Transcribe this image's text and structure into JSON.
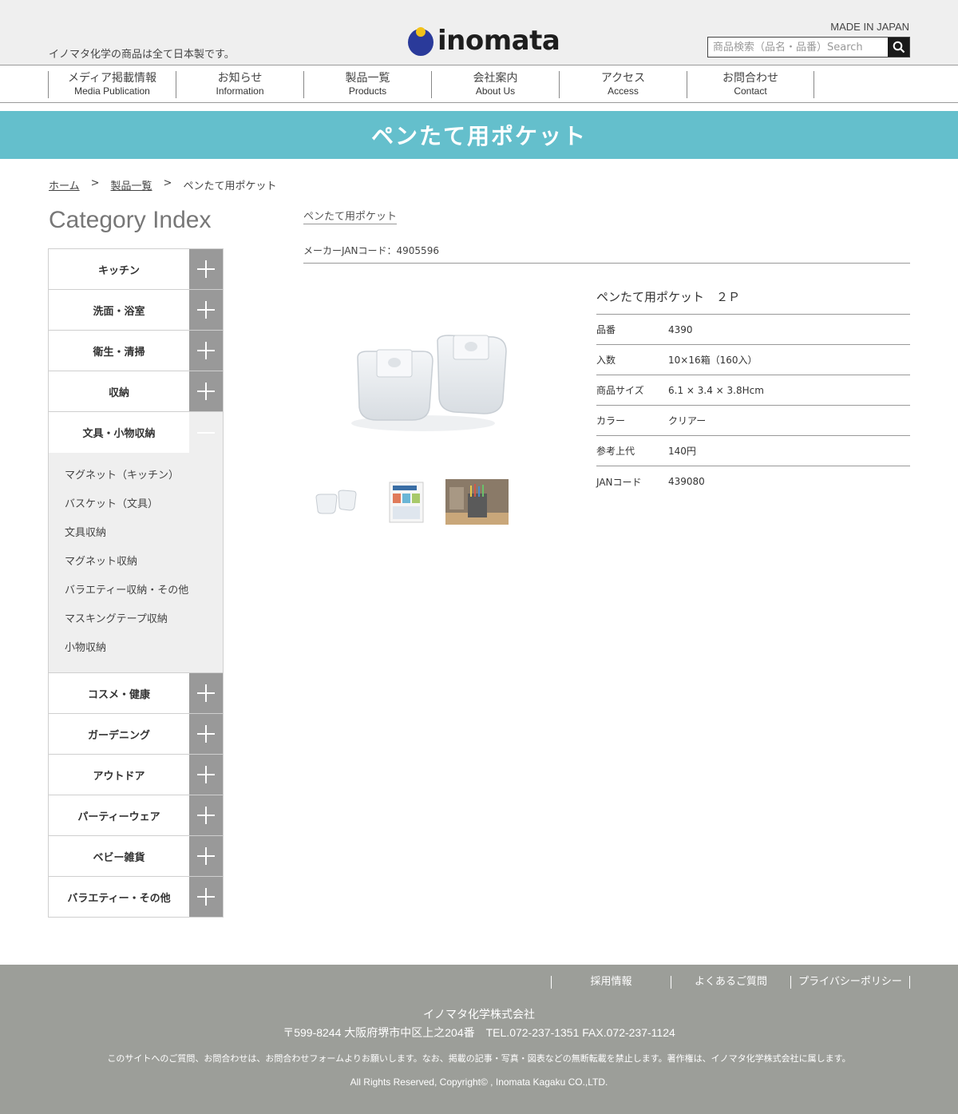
{
  "header": {
    "tagline": "イノマタ化学の商品は全て日本製です。",
    "logo_text": "inomata",
    "made_in": "MADE IN JAPAN",
    "search_placeholder": "商品検索（品名・品番）Search"
  },
  "nav": [
    {
      "jp": "メディア掲載情報",
      "en": "Media Publication"
    },
    {
      "jp": "お知らせ",
      "en": "Information"
    },
    {
      "jp": "製品一覧",
      "en": "Products"
    },
    {
      "jp": "会社案内",
      "en": "About Us"
    },
    {
      "jp": "アクセス",
      "en": "Access"
    },
    {
      "jp": "お問合わせ",
      "en": "Contact"
    }
  ],
  "banner_title": "ペンたて用ポケット",
  "breadcrumb": {
    "home": "ホーム",
    "sep": ">",
    "products": "製品一覧",
    "current": "ペンたて用ポケット"
  },
  "sidebar": {
    "title": "Category Index",
    "categories": [
      {
        "label": "キッチン"
      },
      {
        "label": "洗面・浴室"
      },
      {
        "label": "衛生・清掃"
      },
      {
        "label": "収納"
      },
      {
        "label": "文具・小物収納"
      },
      {
        "label": "コスメ・健康"
      },
      {
        "label": "ガーデニング"
      },
      {
        "label": "アウトドア"
      },
      {
        "label": "パーティーウェア"
      },
      {
        "label": "ベビー雑貨"
      },
      {
        "label": "バラエティー・その他"
      }
    ],
    "sub_items": [
      "マグネット（キッチン）",
      "バスケット（文具）",
      "文具収納",
      "マグネット収納",
      "バラエティー収納・その他",
      "マスキングテープ収納",
      "小物収納"
    ]
  },
  "main": {
    "product_link": "ペンたて用ポケット",
    "maker_jan": "メーカーJANコード：4905596",
    "spec_title": "ペンたて用ポケット　２Ｐ",
    "specs": [
      {
        "label": "品番",
        "value": "4390"
      },
      {
        "label": "入数",
        "value": "10×16箱（160入）"
      },
      {
        "label": "商品サイズ",
        "value": "6.1 × 3.4 × 3.8Hcm"
      },
      {
        "label": "カラー",
        "value": "クリアー"
      },
      {
        "label": "参考上代",
        "value": "140円"
      },
      {
        "label": "JANコード",
        "value": "439080"
      }
    ]
  },
  "footer": {
    "links": [
      "採用情報",
      "よくあるご質問",
      "プライバシーポリシー"
    ],
    "company": "イノマタ化学株式会社",
    "address": "〒599-8244 大阪府堺市中区上之204番　TEL.072-237-1351 FAX.072-237-1124",
    "notice": "このサイトへのご質問、お問合わせは、お問合わせフォームよりお願いします。なお、掲載の記事・写真・図表などの無断転載を禁止します。著作権は、イノマタ化学株式会社に属します。",
    "copyright": "All Rights Reserved, Copyright© , Inomata Kagaku CO.,LTD."
  },
  "colors": {
    "banner": "#64bfcc",
    "toggle": "#999999",
    "footer": "#9c9e99"
  }
}
